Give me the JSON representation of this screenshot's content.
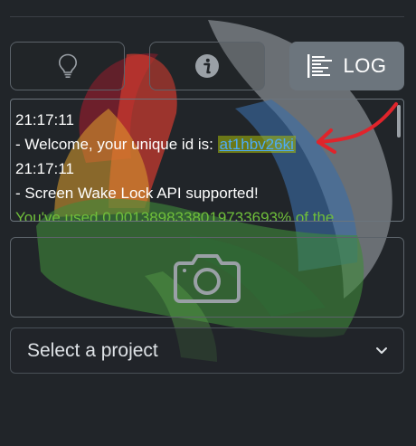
{
  "toolbar": {
    "idea_icon": "lightbulb-icon",
    "info_icon": "info-icon",
    "log_icon": "log-list-icon",
    "log_label": "LOG",
    "log_active_color": "#6c757d"
  },
  "log": {
    "lines": [
      {
        "text": "21:17:11"
      },
      {
        "prefix": "- Welcome, your unique id is: ",
        "link": "at1hbv26ki"
      },
      {
        "text": "21:17:11"
      },
      {
        "text": "- Screen Wake Lock API supported!"
      },
      {
        "text": "You've used 0.0013898338019733693% of the"
      }
    ],
    "usage_color": "#6fbf3a",
    "link_color": "#4dabf7"
  },
  "annotation": {
    "arrow_color": "#e0242b"
  },
  "camera": {
    "icon": "camera-icon"
  },
  "project_select": {
    "placeholder": "Select a project",
    "icon": "chevron-down-icon"
  },
  "theme": {
    "background": "#212529",
    "border": "#5c636a"
  }
}
